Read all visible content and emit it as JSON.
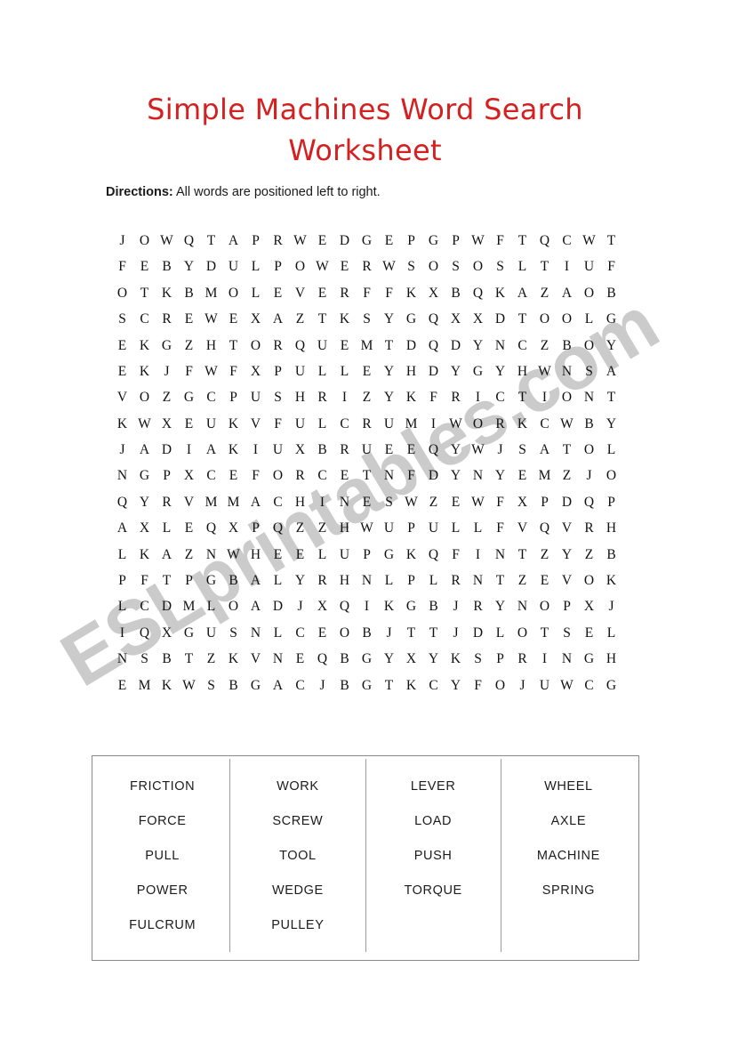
{
  "document": {
    "title_lines": [
      "Simple Machines Word Search",
      "Worksheet"
    ],
    "title_color": "#d42020",
    "watermark_text": "ESLprintables.com"
  },
  "directions": {
    "label": "Directions:",
    "text": " All words are positioned left to right."
  },
  "puzzle": {
    "rows": 18,
    "cols": 24,
    "grid": [
      [
        "J",
        "O",
        "W",
        "Q",
        "T",
        "A",
        "P",
        "R",
        "W",
        "E",
        "D",
        "G",
        "E",
        "P",
        "G",
        "P",
        "W",
        "F",
        "T",
        "Q",
        "C",
        "W",
        "T"
      ],
      [
        "F",
        "E",
        "B",
        "Y",
        "D",
        "U",
        "L",
        "P",
        "O",
        "W",
        "E",
        "R",
        "W",
        "S",
        "O",
        "S",
        "O",
        "S",
        "L",
        "T",
        "I",
        "U",
        "F"
      ],
      [
        "O",
        "T",
        "K",
        "B",
        "M",
        "O",
        "L",
        "E",
        "V",
        "E",
        "R",
        "F",
        "F",
        "K",
        "X",
        "B",
        "Q",
        "K",
        "A",
        "Z",
        "A",
        "O",
        "B"
      ],
      [
        "S",
        "C",
        "R",
        "E",
        "W",
        "E",
        "X",
        "A",
        "Z",
        "T",
        "K",
        "S",
        "Y",
        "G",
        "Q",
        "X",
        "X",
        "D",
        "T",
        "O",
        "O",
        "L",
        "G"
      ],
      [
        "E",
        "K",
        "G",
        "Z",
        "H",
        "T",
        "O",
        "R",
        "Q",
        "U",
        "E",
        "M",
        "T",
        "D",
        "Q",
        "D",
        "Y",
        "N",
        "C",
        "Z",
        "B",
        "O",
        "Y"
      ],
      [
        "E",
        "K",
        "J",
        "F",
        "W",
        "F",
        "X",
        "P",
        "U",
        "L",
        "L",
        "E",
        "Y",
        "H",
        "D",
        "Y",
        "G",
        "Y",
        "H",
        "W",
        "N",
        "S",
        "A"
      ],
      [
        "V",
        "O",
        "Z",
        "G",
        "C",
        "P",
        "U",
        "S",
        "H",
        "R",
        "I",
        "Z",
        "Y",
        "K",
        "F",
        "R",
        "I",
        "C",
        "T",
        "I",
        "O",
        "N",
        "T"
      ],
      [
        "K",
        "W",
        "X",
        "E",
        "U",
        "K",
        "V",
        "F",
        "U",
        "L",
        "C",
        "R",
        "U",
        "M",
        "I",
        "W",
        "O",
        "R",
        "K",
        "C",
        "W",
        "B",
        "Y"
      ],
      [
        "J",
        "A",
        "D",
        "I",
        "A",
        "K",
        "I",
        "U",
        "X",
        "B",
        "R",
        "U",
        "E",
        "E",
        "Q",
        "Y",
        "W",
        "J",
        "S",
        "A",
        "T",
        "O",
        "L"
      ],
      [
        "N",
        "G",
        "P",
        "X",
        "C",
        "E",
        "F",
        "O",
        "R",
        "C",
        "E",
        "T",
        "N",
        "F",
        "D",
        "Y",
        "N",
        "Y",
        "E",
        "M",
        "Z",
        "J",
        "O"
      ],
      [
        "Q",
        "Y",
        "R",
        "V",
        "M",
        "M",
        "A",
        "C",
        "H",
        "I",
        "N",
        "E",
        "S",
        "W",
        "Z",
        "E",
        "W",
        "F",
        "X",
        "P",
        "D",
        "Q",
        "P"
      ],
      [
        "A",
        "X",
        "L",
        "E",
        "Q",
        "X",
        "P",
        "Q",
        "Z",
        "Z",
        "H",
        "W",
        "U",
        "P",
        "U",
        "L",
        "L",
        "F",
        "V",
        "Q",
        "V",
        "R",
        "H"
      ],
      [
        "L",
        "K",
        "A",
        "Z",
        "N",
        "W",
        "H",
        "E",
        "E",
        "L",
        "U",
        "P",
        "G",
        "K",
        "Q",
        "F",
        "I",
        "N",
        "T",
        "Z",
        "Y",
        "Z",
        "B"
      ],
      [
        "P",
        "F",
        "T",
        "P",
        "G",
        "B",
        "A",
        "L",
        "Y",
        "R",
        "H",
        "N",
        "L",
        "P",
        "L",
        "R",
        "N",
        "T",
        "Z",
        "E",
        "V",
        "O",
        "K"
      ],
      [
        "L",
        "C",
        "D",
        "M",
        "L",
        "O",
        "A",
        "D",
        "J",
        "X",
        "Q",
        "I",
        "K",
        "G",
        "B",
        "J",
        "R",
        "Y",
        "N",
        "O",
        "P",
        "X",
        "J"
      ],
      [
        "I",
        "Q",
        "X",
        "G",
        "U",
        "S",
        "N",
        "L",
        "C",
        "E",
        "O",
        "B",
        "J",
        "T",
        "T",
        "J",
        "D",
        "L",
        "O",
        "T",
        "S",
        "E",
        "L"
      ],
      [
        "N",
        "S",
        "B",
        "T",
        "Z",
        "K",
        "V",
        "N",
        "E",
        "Q",
        "B",
        "G",
        "Y",
        "X",
        "Y",
        "K",
        "S",
        "P",
        "R",
        "I",
        "N",
        "G",
        "H"
      ],
      [
        "E",
        "M",
        "K",
        "W",
        "S",
        "B",
        "G",
        "A",
        "C",
        "J",
        "B",
        "G",
        "T",
        "K",
        "C",
        "Y",
        "F",
        "O",
        "J",
        "U",
        "W",
        "C",
        "G"
      ]
    ]
  },
  "word_list": {
    "columns": [
      [
        "FRICTION",
        "FORCE",
        "PULL",
        "POWER",
        "FULCRUM"
      ],
      [
        "WORK",
        "SCREW",
        "TOOL",
        "WEDGE",
        "PULLEY"
      ],
      [
        "LEVER",
        "LOAD",
        "PUSH",
        "TORQUE"
      ],
      [
        "WHEEL",
        "AXLE",
        "MACHINE",
        "SPRING"
      ]
    ]
  }
}
